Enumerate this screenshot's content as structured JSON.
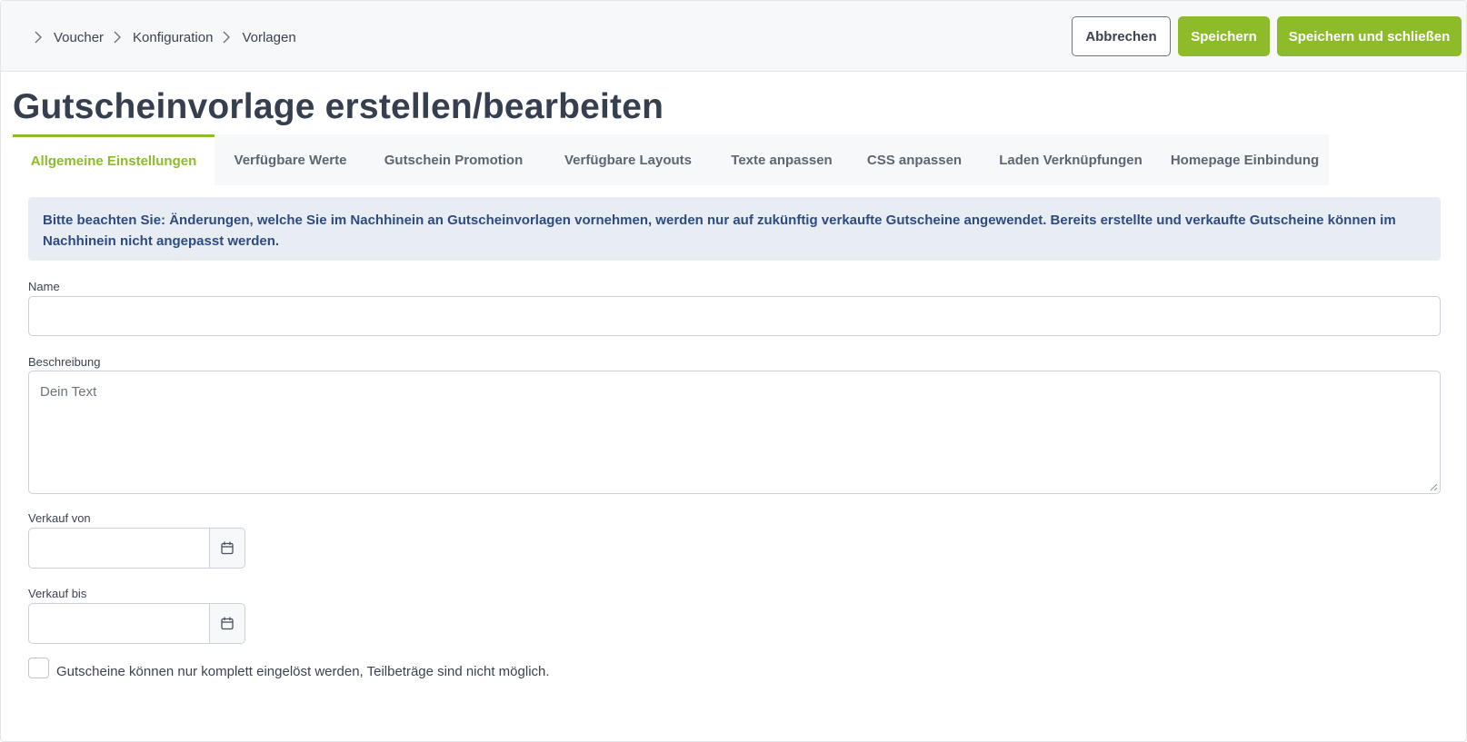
{
  "breadcrumb": [
    "Voucher",
    "Konfiguration",
    "Vorlagen"
  ],
  "actions": {
    "cancel": "Abbrechen",
    "save": "Speichern",
    "save_close": "Speichern und schließen"
  },
  "page_title": "Gutscheinvorlage erstellen/bearbeiten",
  "tabs": [
    "Allgemeine Einstellungen",
    "Verfügbare Werte",
    "Gutschein Promotion",
    "Verfügbare Layouts",
    "Texte anpassen",
    "CSS anpassen",
    "Laden Verknüpfungen",
    "Homepage Einbindung"
  ],
  "active_tab": "Allgemeine Einstellungen",
  "notice": "Bitte beachten Sie: Änderungen, welche Sie im Nachhinein an Gutscheinvorlagen vornehmen, werden nur auf zukünftig verkaufte Gutscheine angewendet. Bereits erstellte und verkaufte Gutscheine können im Nachhinein nicht angepasst werden.",
  "form": {
    "name_label": "Name",
    "name_value": "",
    "description_label": "Beschreibung",
    "description_placeholder": "Dein Text",
    "sale_from_label": "Verkauf von",
    "sale_from_value": "",
    "sale_to_label": "Verkauf bis",
    "sale_to_value": "",
    "checkbox_label": "Gutscheine können nur komplett eingelöst werden, Teilbeträge sind nicht möglich.",
    "checkbox_checked": false
  },
  "colors": {
    "accent": "#8dbb2a",
    "notice_bg": "#e8ecf3",
    "notice_text": "#2d4b82",
    "title": "#353f4f"
  },
  "icons": {
    "breadcrumb_separator": "chevron-right-icon",
    "date_picker": "calendar-icon"
  }
}
